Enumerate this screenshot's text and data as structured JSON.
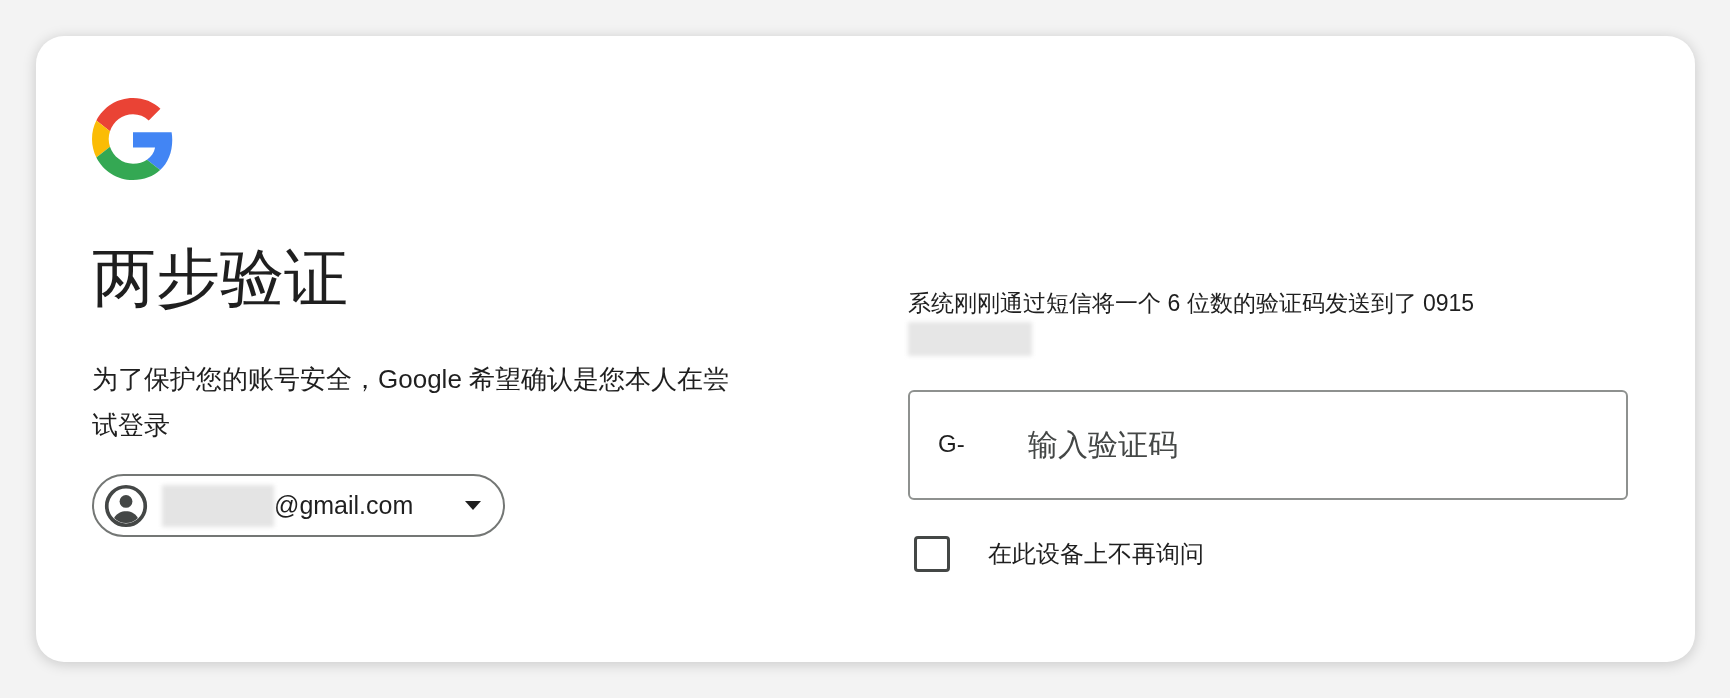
{
  "title": "两步验证",
  "subtitle": "为了保护您的账号安全，Google 希望确认是您本人在尝试登录",
  "account": {
    "email": "@gmail.com"
  },
  "message": "系统刚刚通过短信将一个 6 位数的验证码发送到了 0915",
  "code_field": {
    "prefix": "G-",
    "placeholder": "输入验证码"
  },
  "remember": {
    "label": "在此设备上不再询问",
    "checked": false
  }
}
